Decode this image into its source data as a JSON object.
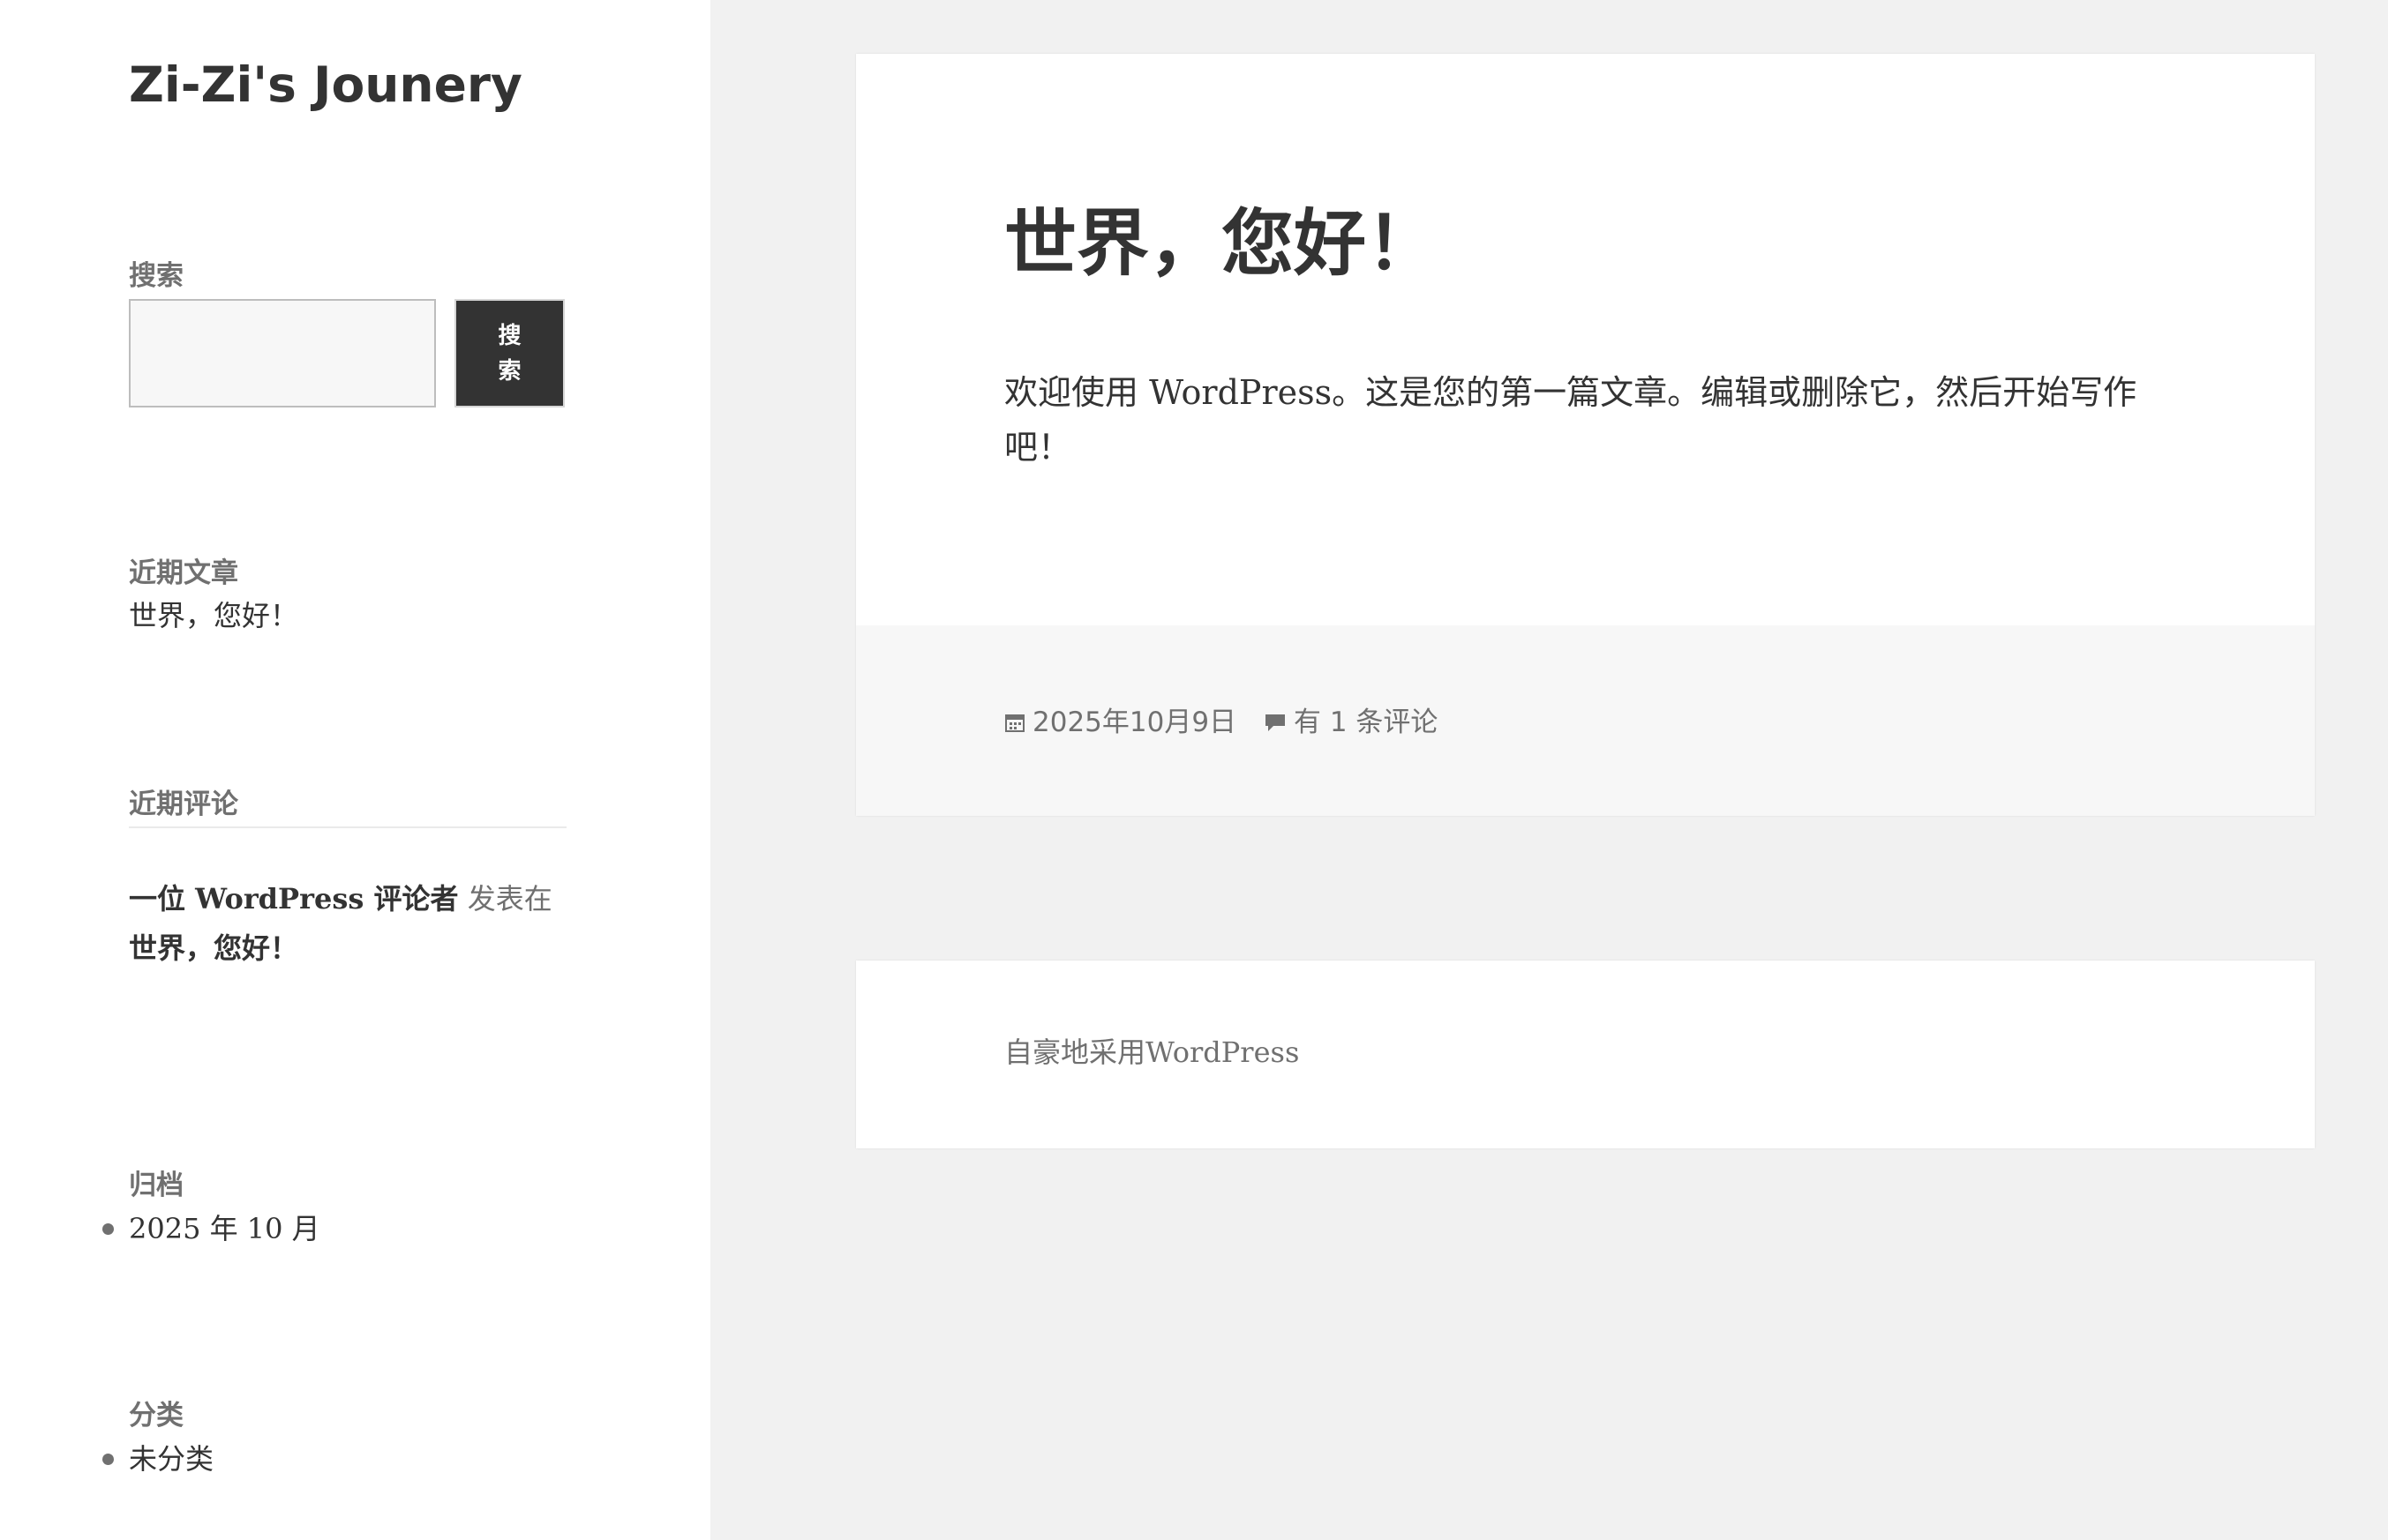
{
  "site": {
    "title": "Zi-Zi's Jounery"
  },
  "sidebar": {
    "search": {
      "title": "搜索",
      "input_value": "",
      "button_label": "搜索"
    },
    "recent_posts": {
      "title": "近期文章",
      "items": [
        {
          "label": "世界，您好！"
        }
      ]
    },
    "recent_comments": {
      "title": "近期评论",
      "items": [
        {
          "author": "一位 WordPress 评论者",
          "separator": "发表在",
          "post": "世界，您好！"
        }
      ]
    },
    "archives": {
      "title": "归档",
      "items": [
        {
          "label": "2025 年 10 月"
        }
      ]
    },
    "categories": {
      "title": "分类",
      "items": [
        {
          "label": "未分类"
        }
      ]
    }
  },
  "post": {
    "title": "世界，您好！",
    "body": "欢迎使用 WordPress。这是您的第一篇文章。编辑或删除它，然后开始写作吧！",
    "date": "2025年10月9日",
    "comments": "有 1 条评论",
    "date_icon": "calendar-icon",
    "comments_icon": "speech-bubble-icon"
  },
  "footer": {
    "credit": "自豪地采用WordPress"
  },
  "colors": {
    "page_background": "#f1f1f1",
    "panel": "#ffffff",
    "text": "#333333",
    "muted_text": "#707070",
    "footer_band": "#f7f7f7",
    "button": "#333333"
  }
}
